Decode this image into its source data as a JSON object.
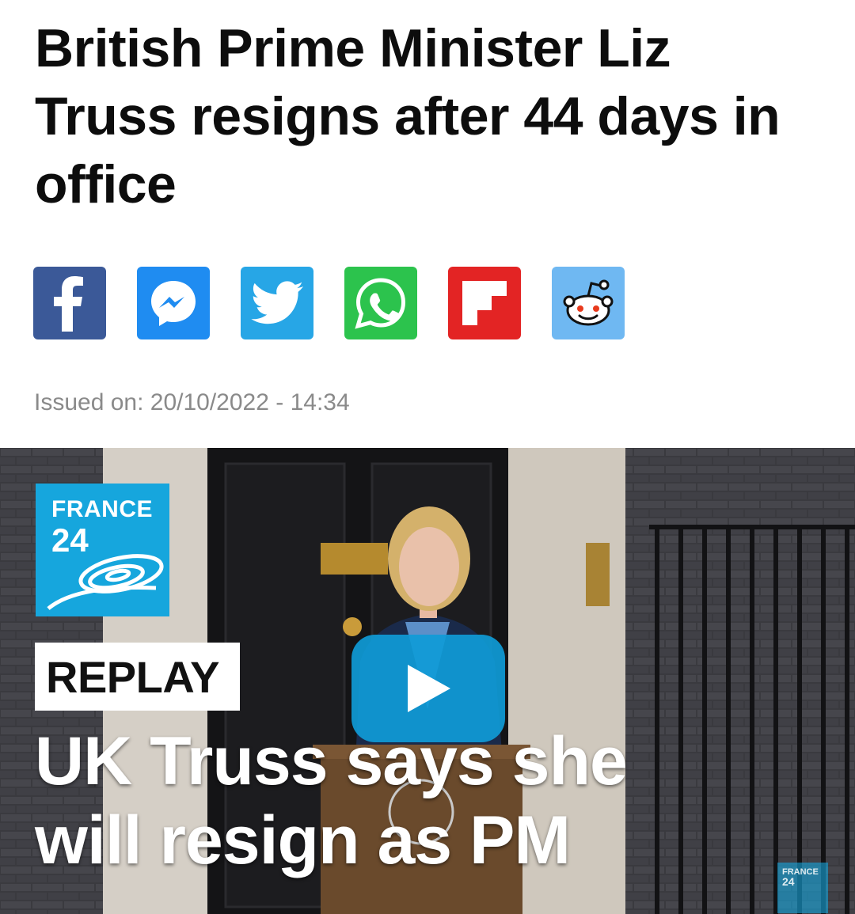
{
  "article": {
    "headline": "British Prime Minister Liz Truss resigns after 44 days in office",
    "issued_on": "Issued on: 20/10/2022 - 14:34"
  },
  "share": [
    {
      "name": "facebook",
      "icon": "facebook-icon",
      "color": "#3b5998"
    },
    {
      "name": "messenger",
      "icon": "messenger-icon",
      "color": "#1f8cf1"
    },
    {
      "name": "twitter",
      "icon": "twitter-icon",
      "color": "#27a6e6"
    },
    {
      "name": "whatsapp",
      "icon": "whatsapp-icon",
      "color": "#2cc34d"
    },
    {
      "name": "flipboard",
      "icon": "flipboard-icon",
      "color": "#e32424"
    },
    {
      "name": "reddit",
      "icon": "reddit-icon",
      "color": "#6fb8f2"
    }
  ],
  "video": {
    "logo_line1": "FRANCE",
    "logo_line2": "24",
    "badge": "REPLAY",
    "caption": "UK Truss says she will resign as PM",
    "watermark_line1": "FRANCE",
    "watermark_line2": "24",
    "play_icon": "play-icon",
    "brand_color": "#16a6dd"
  }
}
